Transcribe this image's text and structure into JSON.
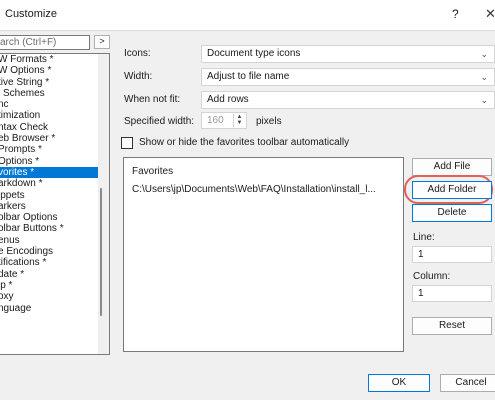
{
  "window": {
    "title": "Customize",
    "help_glyph": "?",
    "close_glyph": "✕"
  },
  "search": {
    "placeholder": "arch (Ctrl+F)",
    "button_label": ">"
  },
  "categories": [
    "W Formats *",
    "W Options *",
    "tive String *",
    "l Schemes",
    "nc",
    "timization",
    "ntax Check",
    "eb Browser *",
    "Prompts *",
    "Options *",
    "vorites *",
    "arkdown *",
    "ippets",
    "arkers",
    "olbar Options",
    "olbar Buttons *",
    "enus",
    "e Encodings",
    "tifications *",
    "date *",
    "lp *",
    "oxy",
    "nguage"
  ],
  "selected_category": "vorites *",
  "settings": {
    "icons_label": "Icons:",
    "icons_value": "Document type icons",
    "width_label": "Width:",
    "width_value": "Adjust to file name",
    "notfit_label": "When not fit:",
    "notfit_value": "Add rows",
    "specified_label": "Specified width:",
    "specified_value": "160",
    "pixels_label": "pixels",
    "show_toolbar_label": "Show or hide the favorites toolbar automatically"
  },
  "favorites": {
    "header": "Favorites",
    "items": [
      "C:\\Users\\jp\\Documents\\Web\\FAQ\\Installation\\install_l..."
    ]
  },
  "side": {
    "add_file": "Add File",
    "add_folder": "Add Folder",
    "delete": "Delete",
    "line_label": "Line:",
    "line_value": "1",
    "column_label": "Column:",
    "column_value": "1",
    "reset": "Reset"
  },
  "footer": {
    "ok": "OK",
    "cancel": "Cancel"
  },
  "colors": {
    "selection": "#0078d7",
    "highlight_ring": "#e0605a"
  }
}
